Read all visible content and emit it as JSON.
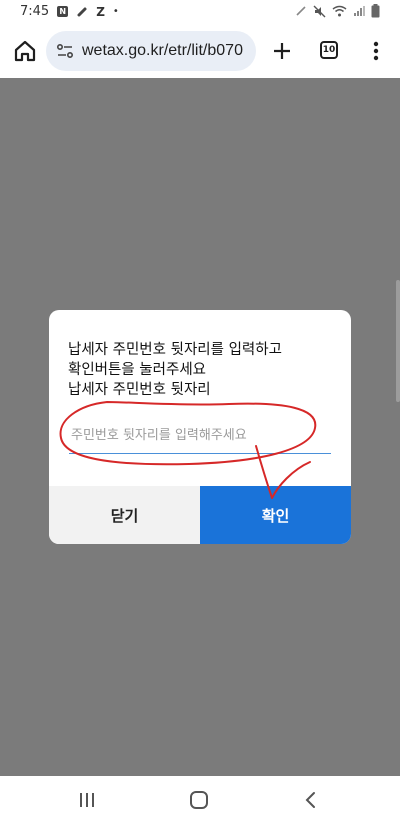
{
  "status_bar": {
    "time": "7:45",
    "notif_n": "N",
    "notif_z": "Z",
    "dot": "•"
  },
  "browser": {
    "url": "wetax.go.kr/etr/lit/b070",
    "tab_count": "10"
  },
  "dialog": {
    "message_lines": [
      "납세자 주민번호 뒷자리를 입력하고",
      "확인버튼을 눌러주세요",
      "납세자 주민번호 뒷자리"
    ],
    "input_placeholder": "주민번호 뒷자리를 입력해주세요",
    "input_value": "",
    "close_label": "닫기",
    "confirm_label": "확인",
    "annotation_color": "#d62828"
  },
  "colors": {
    "overlay": "#7b7b7b",
    "confirm_button": "#1a73d9",
    "close_button": "#f2f2f2",
    "url_bar": "#e9eef6"
  }
}
